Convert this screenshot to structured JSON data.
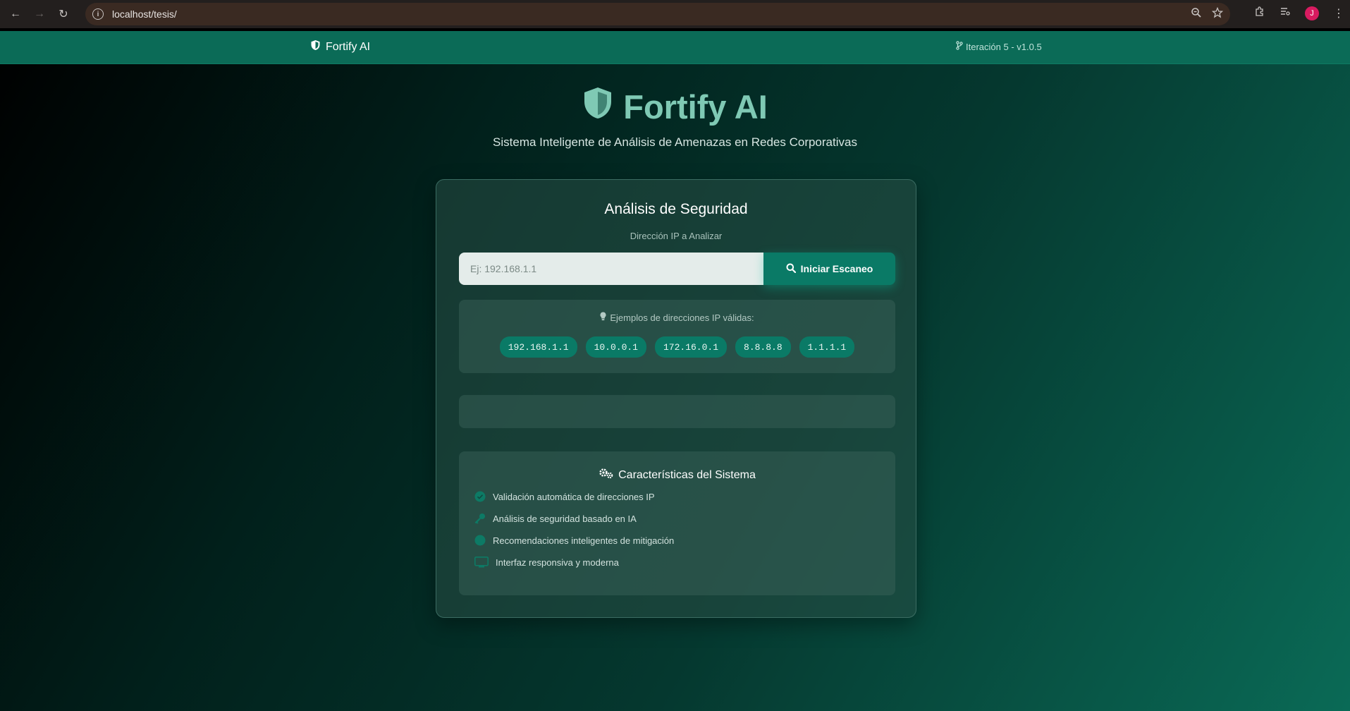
{
  "browser": {
    "url": "localhost/tesis/",
    "avatar_letter": "J"
  },
  "nav": {
    "brand": "Fortify AI",
    "version": "Iteración 5 - v1.0.5"
  },
  "hero": {
    "title": "Fortify AI",
    "subtitle": "Sistema Inteligente de Análisis de Amenazas en Redes Corporativas"
  },
  "scan": {
    "title": "Análisis de Seguridad",
    "ip_label": "Dirección IP a Analizar",
    "ip_placeholder": "Ej: 192.168.1.1",
    "button_label": "Iniciar Escaneo"
  },
  "examples": {
    "label": "Ejemplos de direcciones IP válidas:",
    "ips": [
      "192.168.1.1",
      "10.0.0.1",
      "172.16.0.1",
      "8.8.8.8",
      "1.1.1.1"
    ]
  },
  "features": {
    "title": "Características del Sistema",
    "items": [
      {
        "icon": "check-circle-icon",
        "text": "Validación automática de direcciones IP"
      },
      {
        "icon": "key-icon",
        "text": "Análisis de seguridad basado en IA"
      },
      {
        "icon": "lightbulb-icon",
        "text": "Recomendaciones inteligentes de mitigación"
      },
      {
        "icon": "monitor-icon",
        "text": "Interfaz responsiva y moderna"
      }
    ]
  },
  "colors": {
    "accent": "#0a7a66",
    "nav": "#0b6b57",
    "hero_title": "#7fc9b4"
  }
}
